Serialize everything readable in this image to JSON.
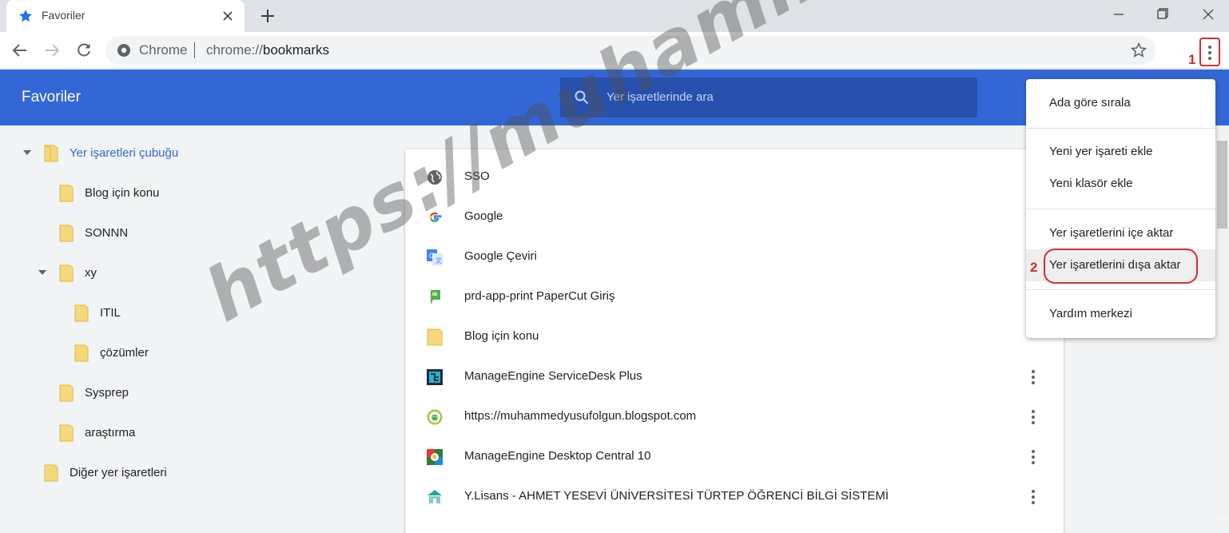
{
  "browser": {
    "tab": {
      "title": "Favoriler",
      "icon": "star-icon",
      "accent": "#1a73e8"
    },
    "omnibox": {
      "scheme": "Chrome",
      "url_prefix": "chrome://",
      "url_host": "bookmarks"
    },
    "annotation_menu": "1",
    "annotation_export": "2"
  },
  "header": {
    "title": "Favoriler",
    "search_placeholder": "Yer işaretlerinde ara",
    "color": "#3367d6"
  },
  "sidebar": {
    "items": [
      {
        "label": "Yer işaretleri çubuğu",
        "expanded": true,
        "selected": true
      },
      {
        "label": "Blog için konu"
      },
      {
        "label": "SONNN"
      },
      {
        "label": "xy",
        "expanded": true
      },
      {
        "label": "ITIL"
      },
      {
        "label": "çözümler"
      },
      {
        "label": "Sysprep"
      },
      {
        "label": "araştırma"
      },
      {
        "label": "Diğer yer işaretleri"
      }
    ]
  },
  "bookmarks": [
    {
      "title": "SSO",
      "icon": "globe-icon"
    },
    {
      "title": "Google",
      "icon": "google-icon"
    },
    {
      "title": "Google Çeviri",
      "icon": "google-translate-icon"
    },
    {
      "title": "prd-app-print PaperCut Giriş",
      "icon": "papercut-icon"
    },
    {
      "title": "Blog için konu",
      "icon": "folder-icon"
    },
    {
      "title": "ManageEngine ServiceDesk Plus",
      "icon": "servicedesk-icon"
    },
    {
      "title": "https://muhammedyusufolgun.blogspot.com",
      "icon": "android-icon"
    },
    {
      "title": "ManageEngine Desktop Central 10",
      "icon": "desktop-central-icon"
    },
    {
      "title": "Y.Lisans - AHMET YESEVİ ÜNİVERSİTESİ TÜRTEP ÖĞRENCİ BİLGİ SİSTEMİ",
      "icon": "university-icon"
    }
  ],
  "menu": {
    "items": [
      {
        "label": "Ada göre sırala"
      },
      {
        "label": "Yeni yer işareti ekle"
      },
      {
        "label": "Yeni klasör ekle"
      },
      {
        "label": "Yer işaretlerini içe aktar"
      },
      {
        "label": "Yer işaretlerini dışa aktar",
        "highlighted": true
      },
      {
        "label": "Yardım merkezi"
      }
    ]
  },
  "watermark": "https://muhammedyusufolgun.blogspot.com"
}
